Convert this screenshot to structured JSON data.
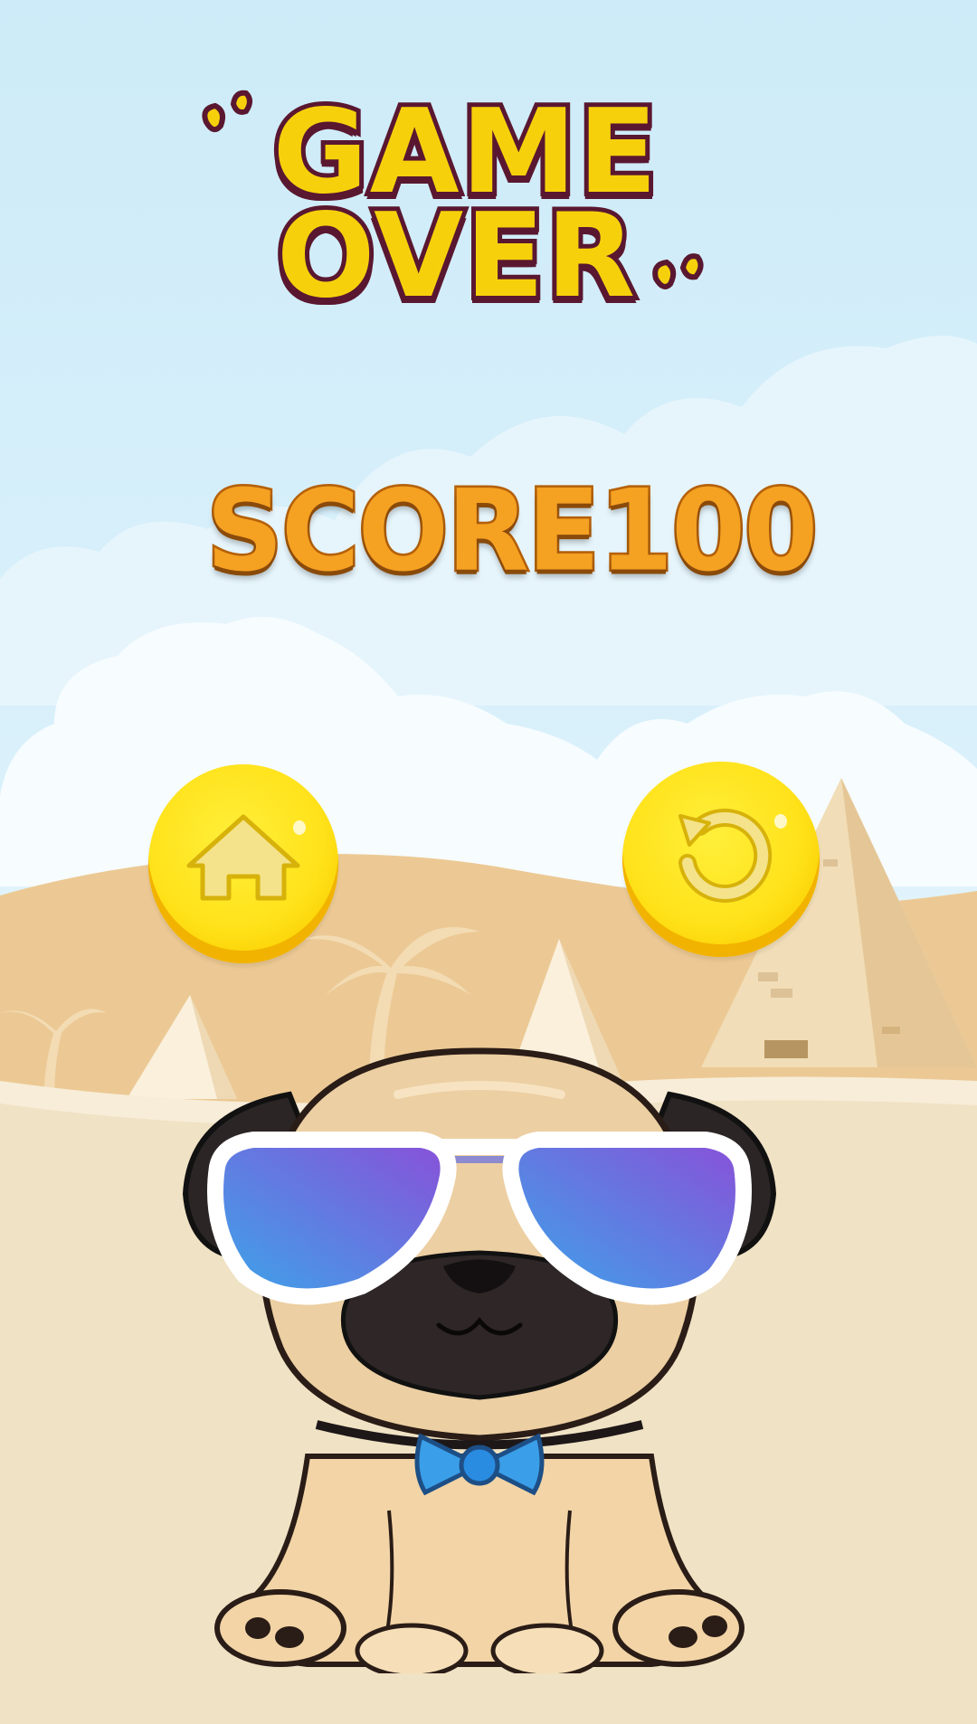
{
  "screen": "game-over",
  "title": {
    "line1": "GAME",
    "line2": "OVER"
  },
  "score": {
    "label": "SCORE",
    "value": "100"
  },
  "buttons": {
    "home": {
      "icon": "home-icon"
    },
    "restart": {
      "icon": "restart-icon"
    }
  },
  "colors": {
    "title_fill": "#f6d10b",
    "title_outline": "#5a1730",
    "score_fill": "#f5a122",
    "button_yellow": "#ffe21a",
    "sky": "#cdebf8",
    "sand": "#f0e2c4"
  }
}
